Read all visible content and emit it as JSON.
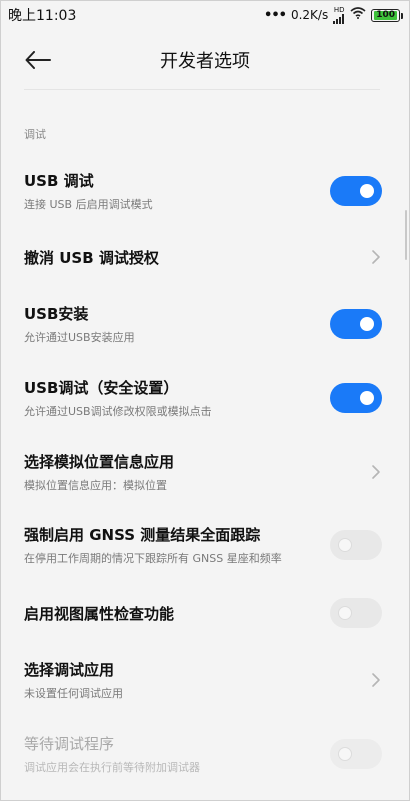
{
  "status": {
    "time": "晚上11:03",
    "dots": "•••",
    "speed": "0.2K/s",
    "network_label": "HD",
    "battery": "100"
  },
  "header": {
    "title": "开发者选项"
  },
  "section": {
    "label": "调试"
  },
  "items": [
    {
      "title": "USB 调试",
      "subtitle": "连接 USB 后启用调试模式",
      "control": "toggle",
      "state": "on"
    },
    {
      "title": "撤消 USB 调试授权",
      "subtitle": "",
      "control": "chevron"
    },
    {
      "title": "USB安装",
      "subtitle": "允许通过USB安装应用",
      "control": "toggle",
      "state": "on"
    },
    {
      "title": "USB调试（安全设置）",
      "subtitle": "允许通过USB调试修改权限或模拟点击",
      "control": "toggle",
      "state": "on"
    },
    {
      "title": "选择模拟位置信息应用",
      "subtitle": "模拟位置信息应用：模拟位置",
      "control": "chevron"
    },
    {
      "title": "强制启用 GNSS 测量结果全面跟踪",
      "subtitle": "在停用工作周期的情况下跟踪所有 GNSS 星座和频率",
      "control": "toggle",
      "state": "off"
    },
    {
      "title": "启用视图属性检查功能",
      "subtitle": "",
      "control": "toggle",
      "state": "off"
    },
    {
      "title": "选择调试应用",
      "subtitle": "未设置任何调试应用",
      "control": "chevron"
    },
    {
      "title": "等待调试程序",
      "subtitle": "调试应用会在执行前等待附加调试器",
      "control": "toggle",
      "state": "off-disabled"
    }
  ],
  "colors": {
    "accent": "#1a7af8",
    "background": "#f4f4f4"
  }
}
